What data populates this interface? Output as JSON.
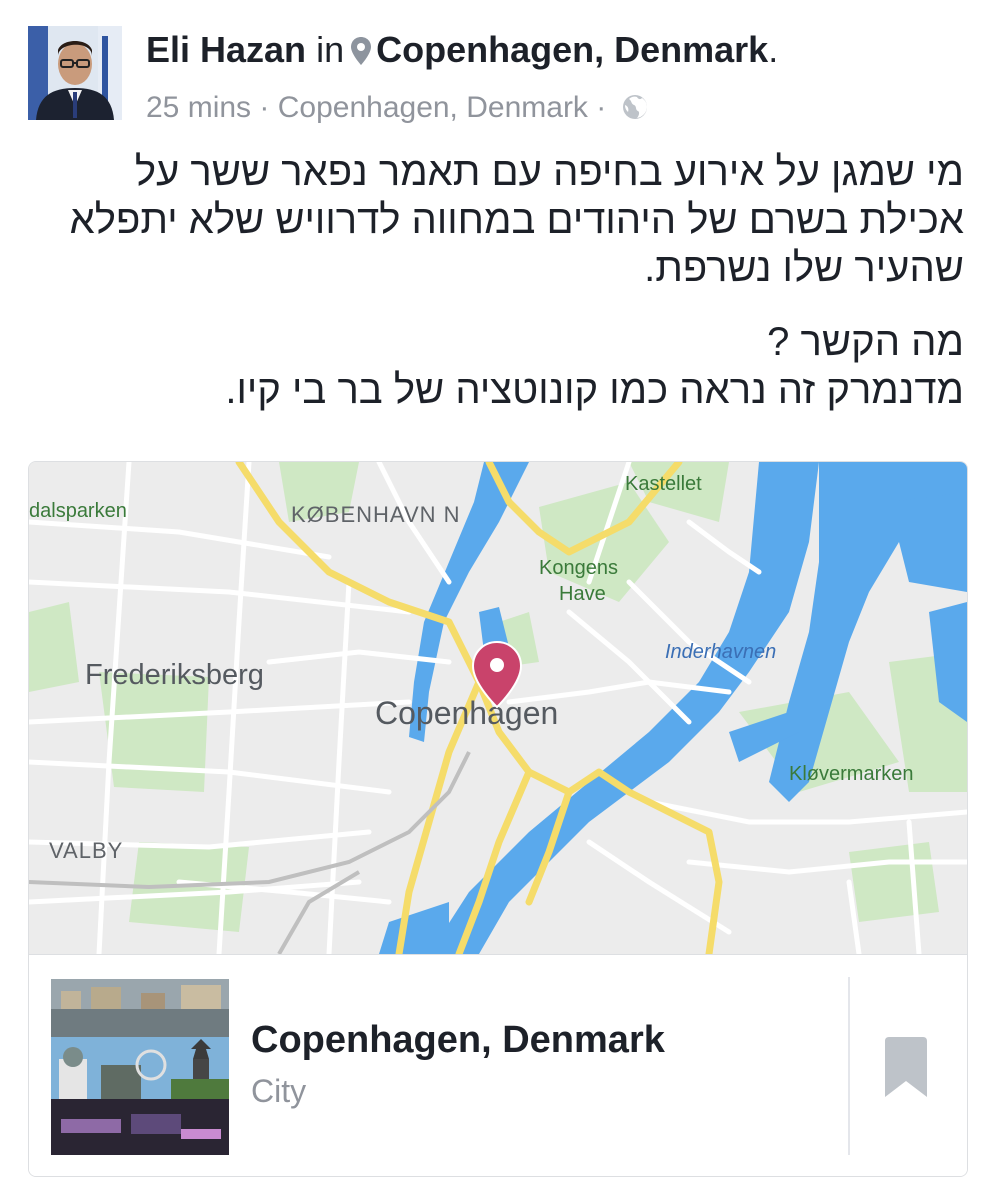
{
  "post": {
    "author": "Eli Hazan",
    "in_word": "in",
    "location": "Copenhagen, Denmark",
    "period": ".",
    "time": "25 mins",
    "separator": "·",
    "meta_location": "Copenhagen, Denmark",
    "privacy_icon": "globe-icon",
    "location_icon": "map-pin-icon",
    "body_paragraph_1": "מי שמגן על אירוע בחיפה עם תאמר נפאר ששר על אכילת בשרם של היהודים במחווה לדרוויש שלא יתפלא שהעיר שלו נשרפת.",
    "body_line_2a": "מה הקשר ?",
    "body_line_2b": "מדנמרק זה נראה כמו קונוטציה של בר בי קיו."
  },
  "map": {
    "labels": {
      "faelledparken": "dalsparken",
      "kobenhavn_n": "KØBENHAVN N",
      "kastellet": "Kastellet",
      "kongens_have_1": "Kongens",
      "kongens_have_2": "Have",
      "frederiksberg": "Frederiksberg",
      "inderhavnen": "Inderhavnen",
      "copenhagen": "Copenhagen",
      "klovermarken": "Kløvermarken",
      "valby": "VALBY"
    },
    "colors": {
      "land": "#ececec",
      "water": "#5aa9ec",
      "park": "#cfe8c4",
      "major_road": "#f5dc6a",
      "minor_road": "#ffffff",
      "pin": "#c9436b"
    }
  },
  "place_card": {
    "title": "Copenhagen, Denmark",
    "category": "City",
    "save_icon": "bookmark-icon"
  }
}
